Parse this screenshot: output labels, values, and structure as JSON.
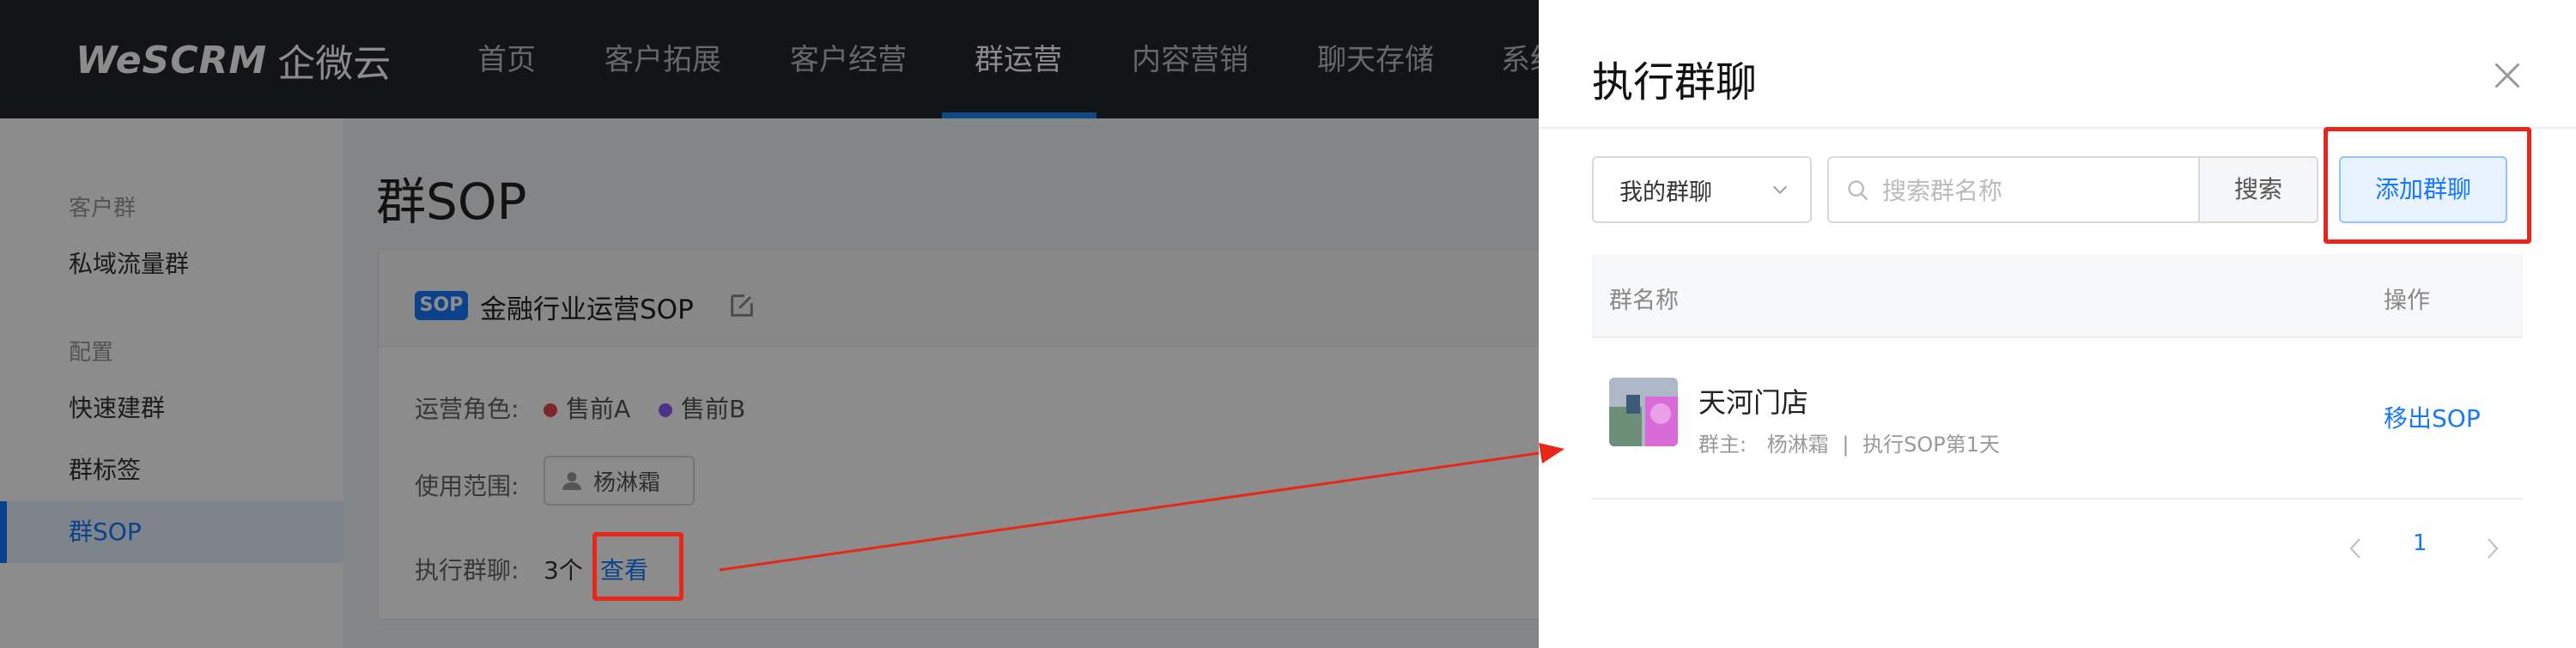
{
  "app": {
    "logo_wordmark": "WeSCRM",
    "logo_cn": "企微云"
  },
  "topnav": {
    "items": [
      "首页",
      "客户拓展",
      "客户经营",
      "群运营",
      "内容营销",
      "聊天存储",
      "系统"
    ],
    "active": "群运营"
  },
  "sidebar": {
    "group1": "客户群",
    "item_private": "私域流量群",
    "group2": "配置",
    "item_quick": "快速建群",
    "item_tags": "群标签",
    "item_sop": "群SOP"
  },
  "main": {
    "title": "群SOP",
    "sop_tag": "SOP",
    "sop_name": "金融行业运营SOP",
    "roles_label": "运营角色:",
    "roles": [
      {
        "name": "售前A",
        "color": "#e5484d"
      },
      {
        "name": "售前B",
        "color": "#8b5cf6"
      }
    ],
    "scope_label": "使用范围:",
    "scope_user": "杨淋霜",
    "exec_label": "执行群聊:",
    "exec_count": "3个",
    "view_link": "查看"
  },
  "drawer": {
    "title": "执行群聊",
    "filter_select": "我的群聊",
    "search_placeholder": "搜索群名称",
    "search_button": "搜索",
    "add_button": "添加群聊",
    "table": {
      "col_name": "群名称",
      "col_action": "操作",
      "rows": [
        {
          "name": "天河门店",
          "owner_label": "群主:",
          "owner": "杨淋霜",
          "separator": "|",
          "status": "执行SOP第1天",
          "action": "移出SOP"
        }
      ]
    },
    "pagination": {
      "current": "1"
    }
  },
  "colors": {
    "accent": "#1677ff",
    "annotation": "#e8261a",
    "nav_bg": "#22252d"
  }
}
